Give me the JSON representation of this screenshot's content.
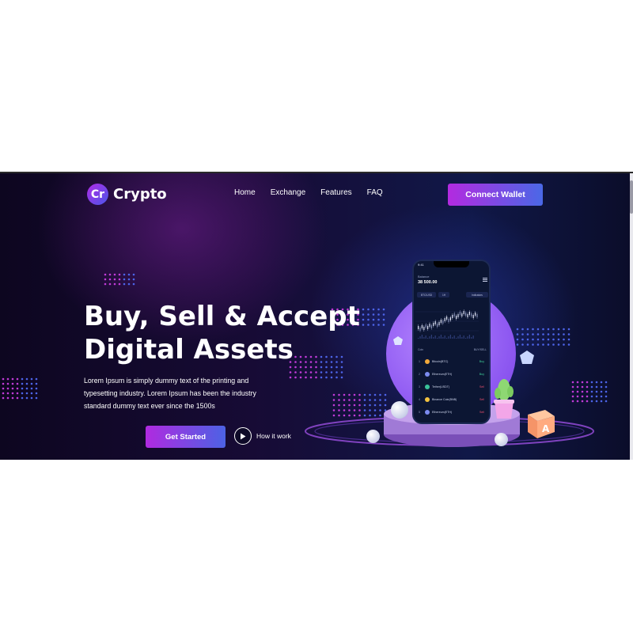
{
  "brand": {
    "badge": "Cr",
    "name": "Crypto"
  },
  "nav": {
    "items": [
      "Home",
      "Exchange",
      "Features",
      "FAQ"
    ]
  },
  "header": {
    "connect_label": "Connect Wallet"
  },
  "hero": {
    "title_line1": "Buy, Sell & Accept",
    "title_line2": "Digital Assets",
    "description": "Lorem Ipsum is simply dummy text of the printing and typesetting industry. Lorem Ipsum has been the industry standard dummy text ever since the 1500s",
    "cta_primary": "Get Started",
    "cta_secondary": "How it work"
  },
  "phone": {
    "time": "9:41",
    "balance_label": "Balance",
    "balance_value": "38 500.00",
    "pills": [
      "BTC/USD",
      "1H",
      "Indicators"
    ],
    "list_header_left": "Coin",
    "list_header_right": "BUY/SELL",
    "coins": [
      {
        "num": "1",
        "name": "Bitcoin(BTC)",
        "action": "Buy",
        "color": "#f2a93b",
        "action_color": "#3fd39b"
      },
      {
        "num": "2",
        "name": "Ethereum(ETH)",
        "action": "Buy",
        "color": "#7c8bf0",
        "action_color": "#3fd39b"
      },
      {
        "num": "3",
        "name": "Tether(USDT)",
        "action": "Sell",
        "color": "#3ac29a",
        "action_color": "#f0506e"
      },
      {
        "num": "4",
        "name": "Binance Coin(BNB)",
        "action": "Sell",
        "color": "#f3c240",
        "action_color": "#f0506e"
      },
      {
        "num": "5",
        "name": "Ethereum(ETH)",
        "action": "Sell",
        "color": "#7c8bf0",
        "action_color": "#f0506e"
      }
    ]
  },
  "colors": {
    "accent_purple": "#b02ae0",
    "accent_blue": "#4a68e6",
    "background_dark": "#0d0620",
    "dot_magenta": "#c13bd8",
    "dot_blue": "#4d64e8"
  },
  "icons": {
    "play": "play-icon",
    "menu": "hamburger-icon"
  }
}
